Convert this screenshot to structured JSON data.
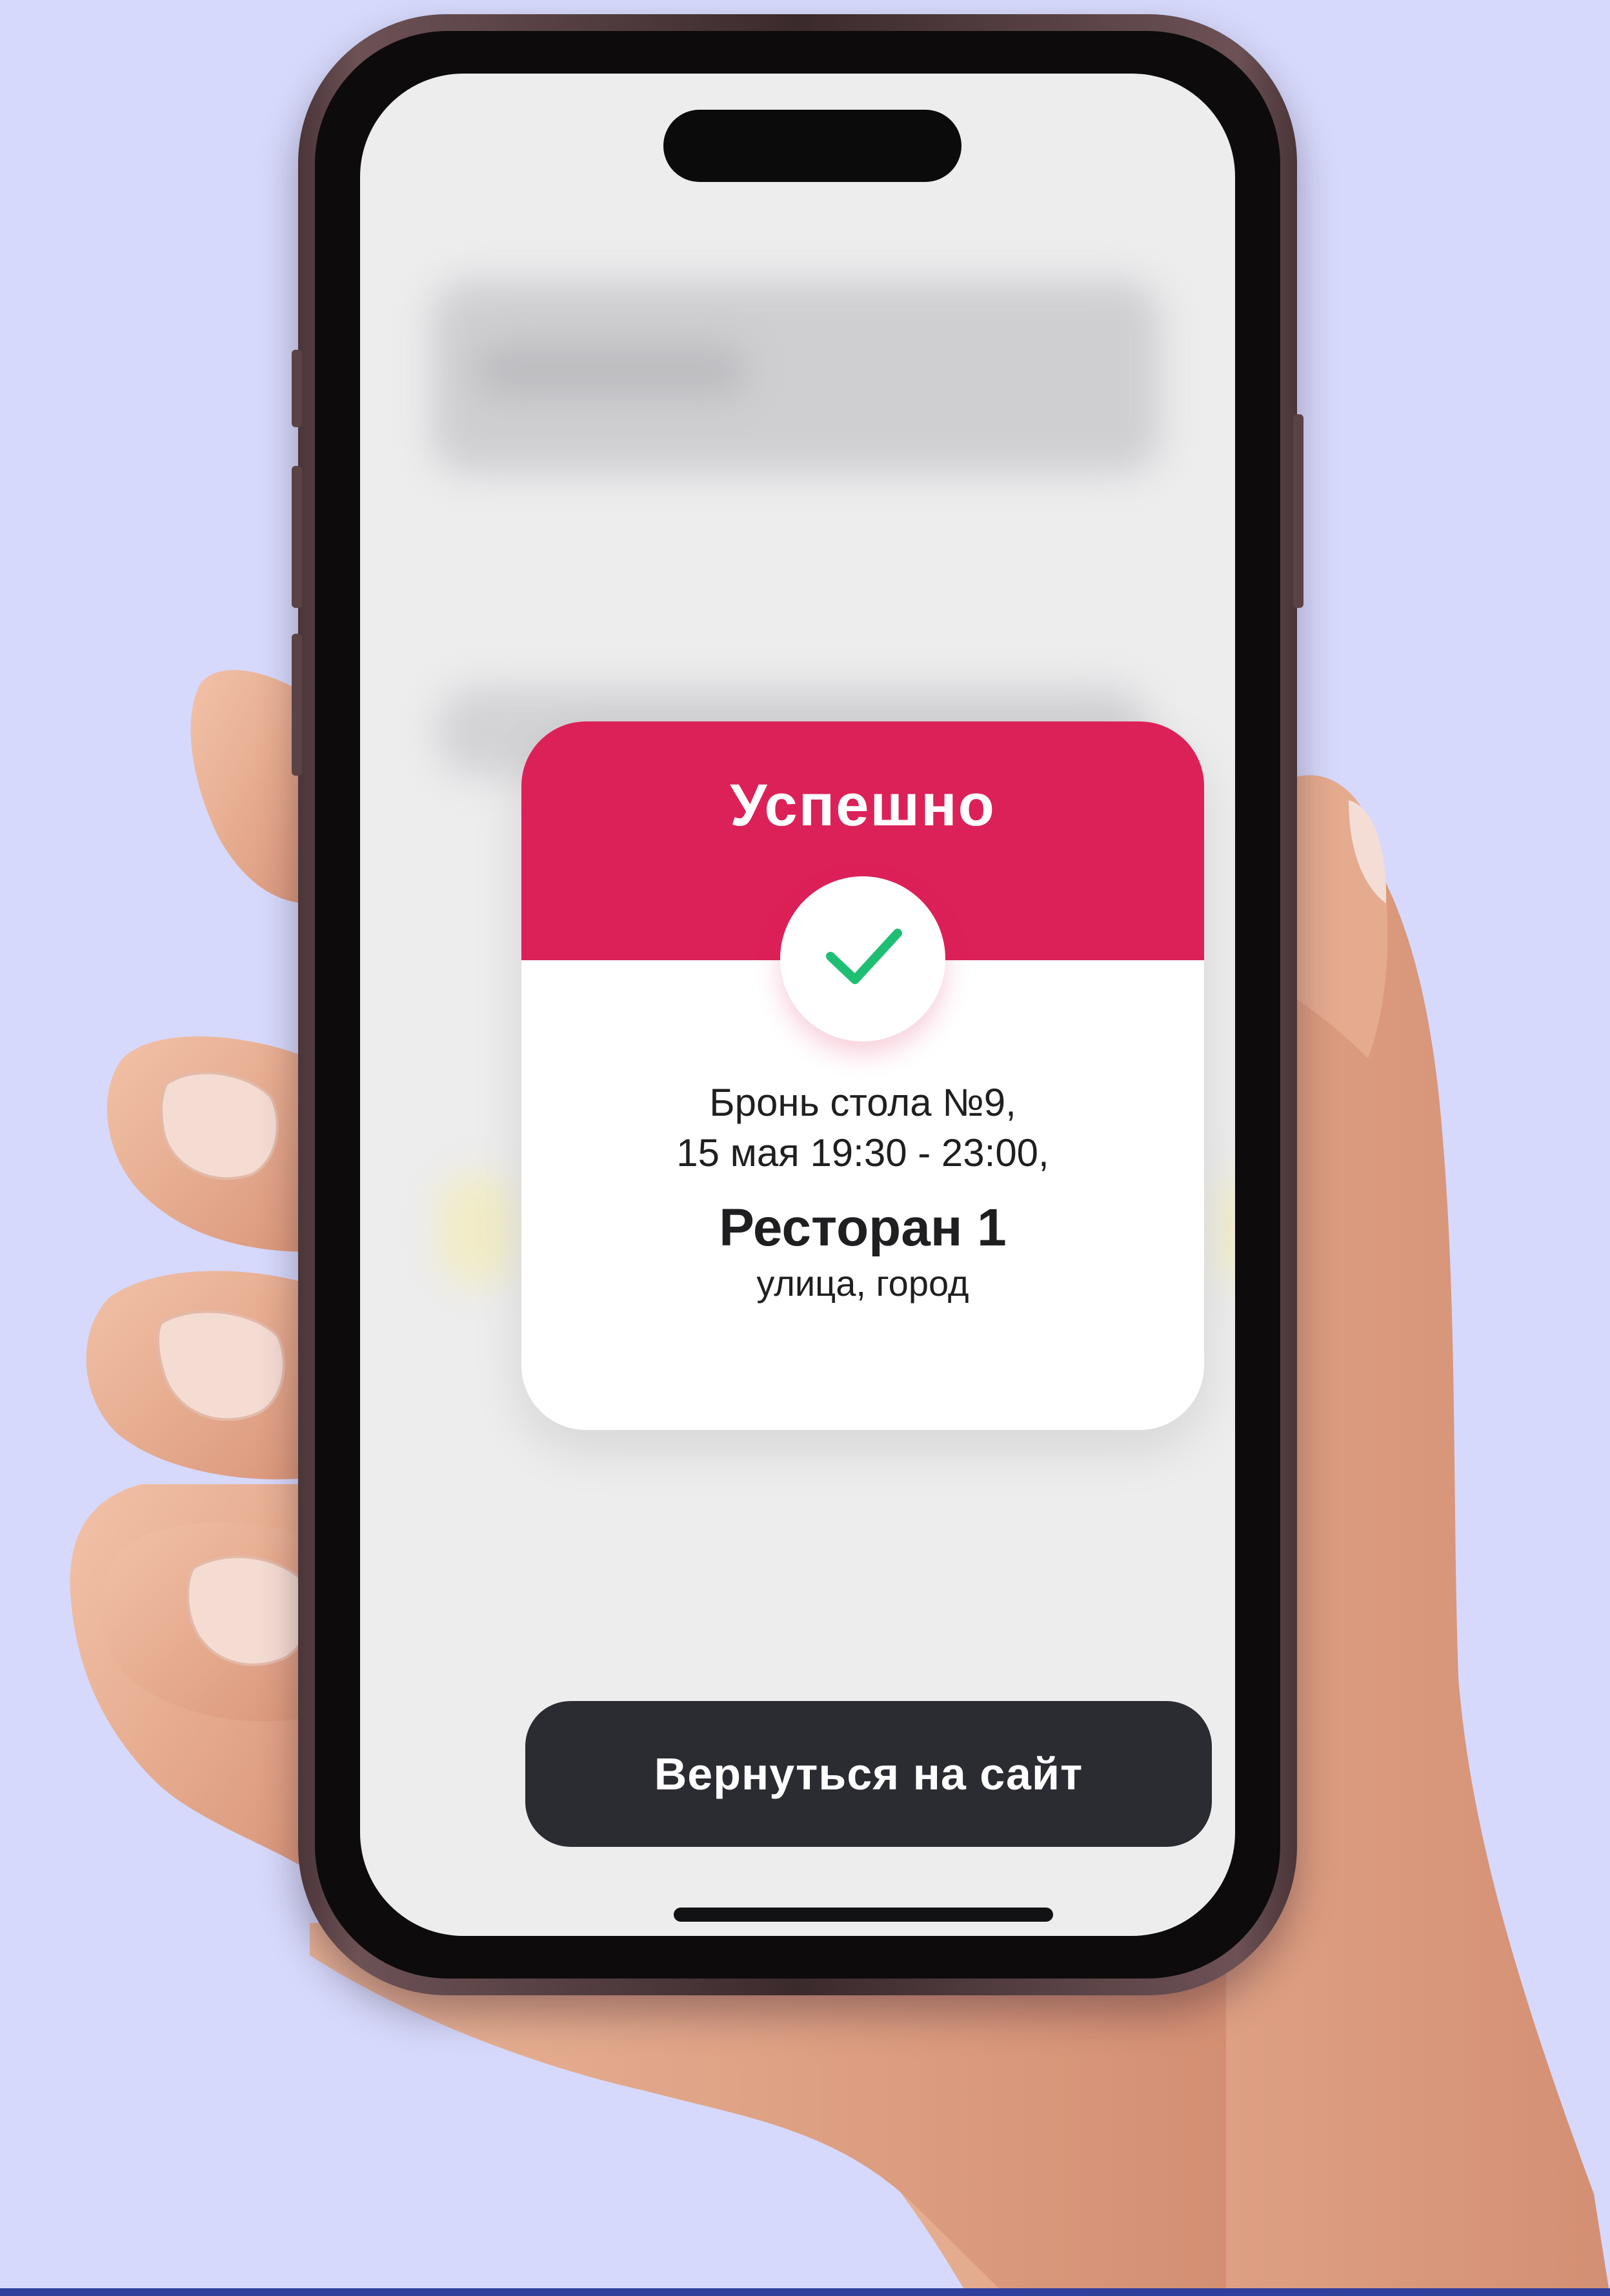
{
  "colors": {
    "background": "#d6d9fb",
    "accent": "#dc2158",
    "check": "#1fbf73",
    "button": "#2b2c32"
  },
  "dialog": {
    "title": "Успешно",
    "icon": "checkmark-icon",
    "booking_line": "Бронь стола №9,",
    "datetime_line": "15 мая 19:30 - 23:00,",
    "restaurant_name": "Ресторан 1",
    "address": "улица, город"
  },
  "footer": {
    "return_button_label": "Вернуться на сайт"
  }
}
